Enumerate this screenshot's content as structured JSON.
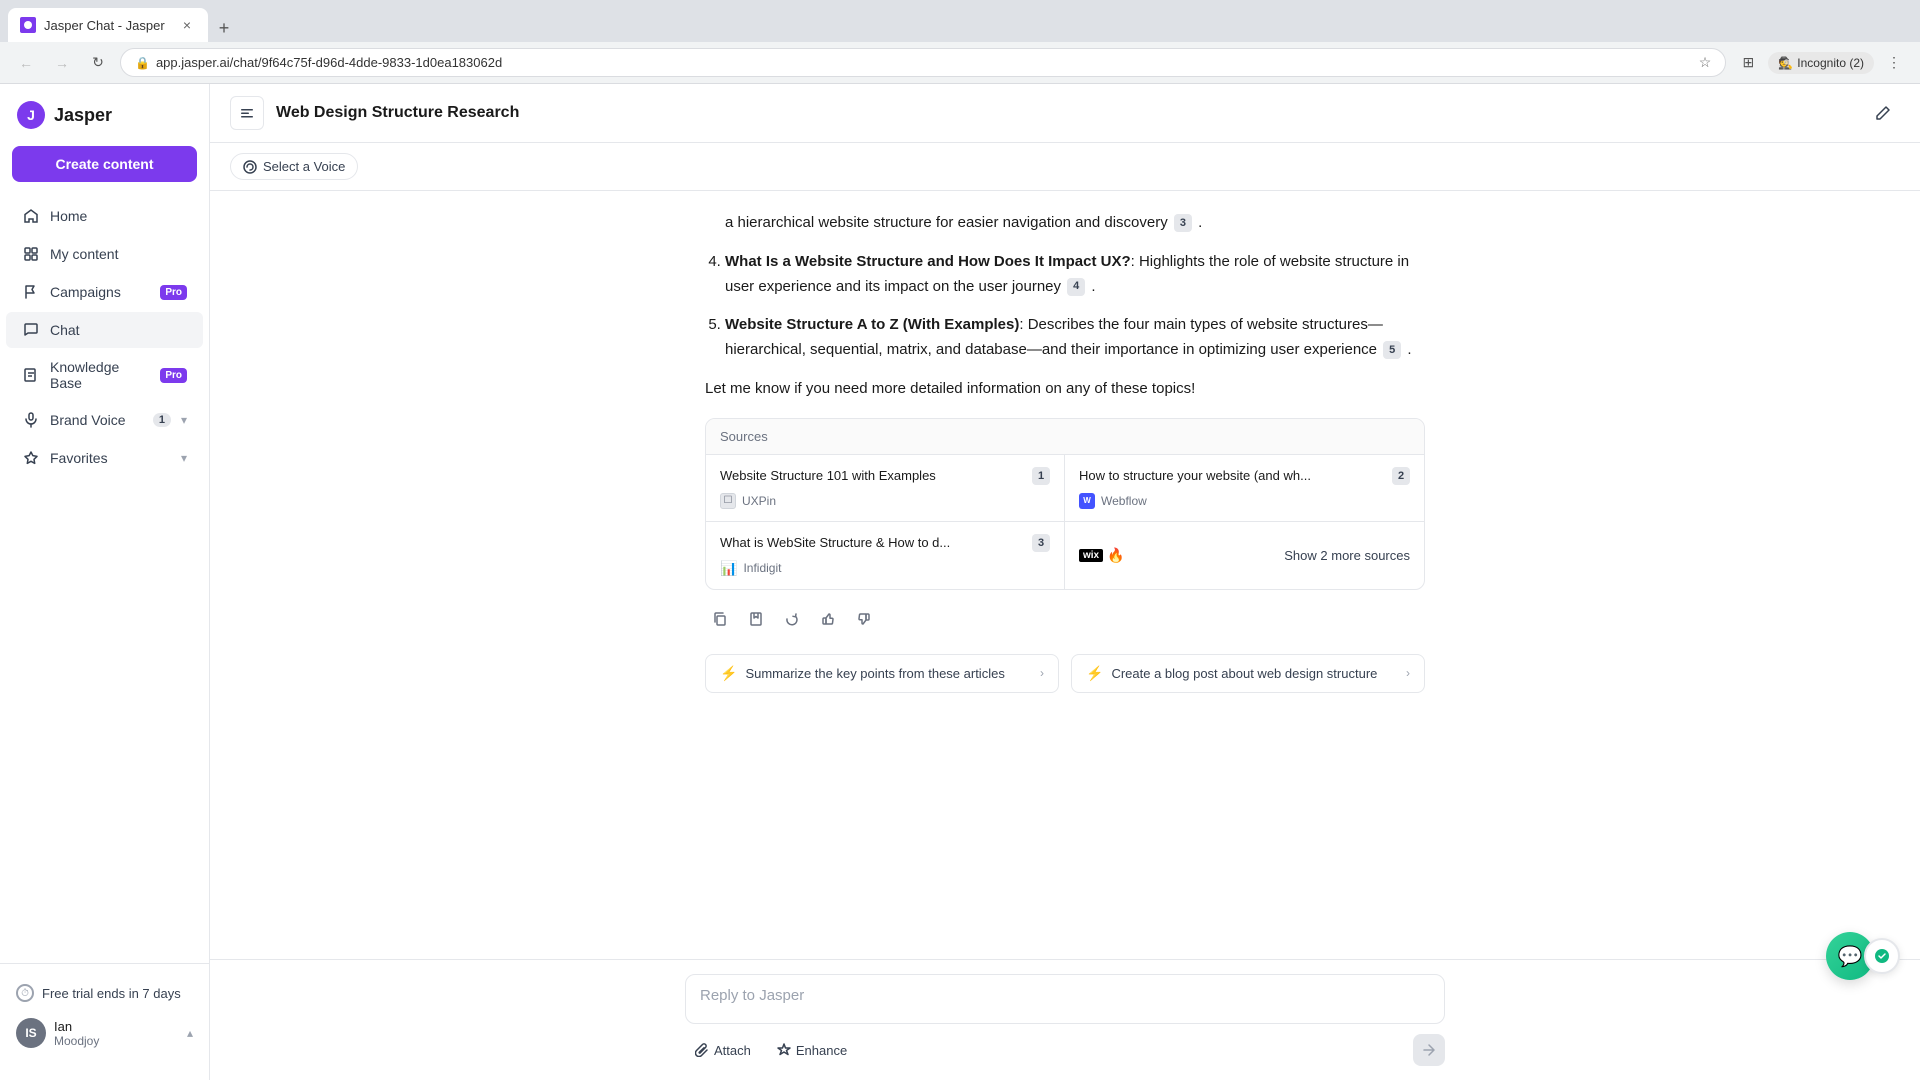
{
  "browser": {
    "tab_title": "Jasper Chat - Jasper",
    "tab_close": "×",
    "tab_new": "+",
    "url": "app.jasper.ai/chat/9f64c75f-d96d-4dde-9833-1d0ea183062d",
    "nav_back": "←",
    "nav_forward": "→",
    "nav_reload": "↻",
    "incognito_label": "Incognito (2)"
  },
  "sidebar": {
    "logo_text": "Jasper",
    "create_btn": "Create content",
    "nav_items": [
      {
        "label": "Home",
        "icon": "home"
      },
      {
        "label": "My content",
        "icon": "grid"
      },
      {
        "label": "Campaigns",
        "icon": "flag",
        "badge": "Pro"
      },
      {
        "label": "Chat",
        "icon": "chat",
        "active": true
      },
      {
        "label": "Knowledge Base",
        "icon": "book",
        "badge": "Pro"
      },
      {
        "label": "Brand Voice",
        "icon": "mic",
        "count": "1",
        "chevron": true
      },
      {
        "label": "Favorites",
        "icon": "star",
        "chevron": true
      }
    ],
    "trial_text": "Free trial ends in 7 days",
    "user_name": "Ian",
    "user_sub": "Moodjoy"
  },
  "header": {
    "title": "Web Design Structure Research",
    "voice_btn": "Select a Voice"
  },
  "chat": {
    "list_items": [
      {
        "number": "4",
        "title": "What Is a Website Structure and How Does It Impact UX?",
        "colon": ":",
        "body": " Highlights the role of website structure in user experience and its impact on the user journey",
        "cite": "4"
      },
      {
        "number": "5",
        "title": "Website Structure A to Z (With Examples)",
        "colon": ":",
        "body": " Describes the four main types of website structures—hierarchical, sequential, matrix, and database—and their importance in optimizing user experience",
        "cite": "5"
      }
    ],
    "partial_text": "a hierarchical website structure for easier navigation and discovery",
    "partial_cite": "3",
    "follow_up": "Let me know if you need more detailed information on any of these topics!",
    "sources_label": "Sources",
    "sources": [
      {
        "title": "Website Structure 101 with Examples",
        "num": "1",
        "site": "UXPin",
        "site_type": "uxpin"
      },
      {
        "title": "How to structure your website (and wh...",
        "num": "2",
        "site": "Webflow",
        "site_type": "webflow"
      },
      {
        "title": "What is WebSite Structure & How to d...",
        "num": "3",
        "site": "Infidigit",
        "site_type": "chart"
      }
    ],
    "show_more": "Show 2 more sources",
    "actions": [
      "copy",
      "save",
      "refresh",
      "thumbup",
      "thumbdown"
    ],
    "suggestions": [
      {
        "text": "Summarize the key points from these articles"
      },
      {
        "text": "Create a blog post about web design structure"
      }
    ]
  },
  "input": {
    "placeholder": "Reply to Jasper",
    "attach_label": "Attach",
    "enhance_label": "Enhance"
  }
}
